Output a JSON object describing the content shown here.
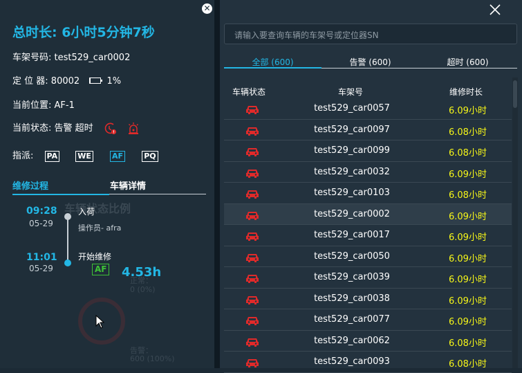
{
  "left_panel": {
    "total_duration": "总时长: 6小时5分钟7秒",
    "frame_no_label": "车架号码:",
    "frame_no_value": "test529_car0002",
    "locator_label": "定 位 器:",
    "locator_value": "80002",
    "battery_percent": "1%",
    "battery_level": 0.01,
    "position_label": "当前位置:",
    "position_value": "AF-1",
    "status_label": "当前状态:",
    "status_value": "告警 超时",
    "assign_label": "指派:",
    "assign_tags": [
      "PA",
      "WE",
      "AF",
      "PQ"
    ],
    "tabs": [
      "维修过程",
      "车辆详情"
    ],
    "timeline": [
      {
        "time": "09:28",
        "date": "05-29",
        "title": "入荷",
        "sub": "操作员- afra"
      },
      {
        "time": "11:01",
        "date": "05-29",
        "title": "开始维修",
        "badge": "AF"
      }
    ],
    "hours_value": "4.53h",
    "ghost_chart": {
      "title": "车辆状态比例",
      "normal_label": "正常：",
      "normal_value": "0 (0%)",
      "alarm_label": "告警：",
      "alarm_value": "600 (100%)"
    }
  },
  "right_panel": {
    "search_placeholder": "请输入要查询车辆的车架号或定位器SN",
    "tabs": [
      "全部 (600)",
      "告警 (600)",
      "超时 (600)"
    ],
    "columns": [
      "车辆状态",
      "车架号",
      "维修时长"
    ],
    "rows": [
      {
        "frame": "test529_car0057",
        "duration": "6.09小时"
      },
      {
        "frame": "test529_car0097",
        "duration": "6.08小时"
      },
      {
        "frame": "test529_car0099",
        "duration": "6.08小时"
      },
      {
        "frame": "test529_car0032",
        "duration": "6.09小时"
      },
      {
        "frame": "test529_car0103",
        "duration": "6.08小时"
      },
      {
        "frame": "test529_car0002",
        "duration": "6.09小时"
      },
      {
        "frame": "test529_car0017",
        "duration": "6.09小时"
      },
      {
        "frame": "test529_car0050",
        "duration": "6.09小时"
      },
      {
        "frame": "test529_car0039",
        "duration": "6.09小时"
      },
      {
        "frame": "test529_car0038",
        "duration": "6.09小时"
      },
      {
        "frame": "test529_car0077",
        "duration": "6.09小时"
      },
      {
        "frame": "test529_car0062",
        "duration": "6.08小时"
      },
      {
        "frame": "test529_car0093",
        "duration": "6.08小时"
      }
    ]
  },
  "colors": {
    "accent": "#23b7e5",
    "alarm": "#e02a2a",
    "duration": "#f7f718",
    "af_badge": "#3ec236"
  }
}
